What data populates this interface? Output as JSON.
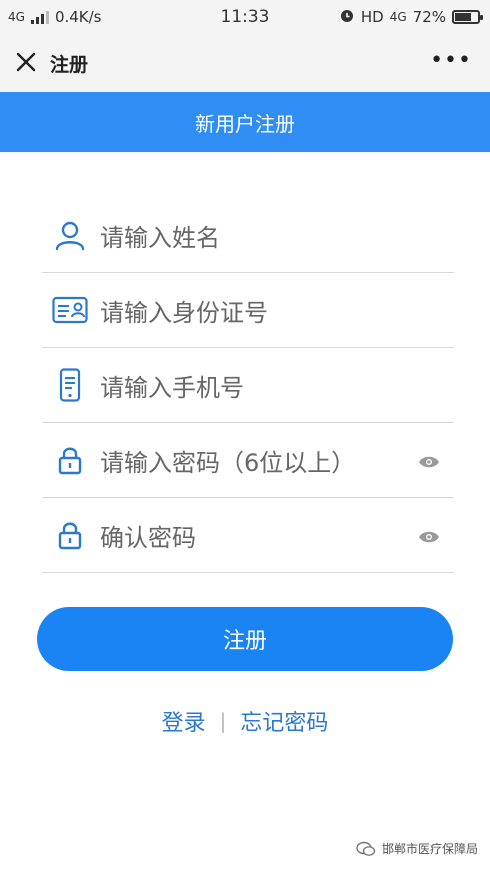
{
  "status_bar": {
    "network": "4G",
    "speed": "0.4K/s",
    "time": "11:33",
    "hd": "HD",
    "network_right": "4G",
    "battery_percent": "72%",
    "battery_level": 0.72
  },
  "navbar": {
    "close_icon": "close-icon",
    "title": "注册",
    "more_label": "•••"
  },
  "banner": {
    "title": "新用户注册"
  },
  "form": {
    "name": {
      "placeholder": "请输入姓名",
      "icon": "user-icon"
    },
    "id_number": {
      "placeholder": "请输入身份证号",
      "icon": "id-card-icon"
    },
    "phone": {
      "placeholder": "请输入手机号",
      "icon": "phone-icon"
    },
    "password": {
      "placeholder": "请输入密码（6位以上）",
      "icon": "lock-icon"
    },
    "confirm_password": {
      "placeholder": "确认密码",
      "icon": "lock-icon"
    }
  },
  "submit_label": "注册",
  "links": {
    "login": "登录",
    "separator": "|",
    "forgot": "忘记密码"
  },
  "watermark": {
    "text": "邯郸市医疗保障局"
  },
  "colors": {
    "accent": "#1a84f5",
    "banner": "#2f8df3",
    "link": "#2a79cc",
    "icon": "#2a79cc"
  }
}
